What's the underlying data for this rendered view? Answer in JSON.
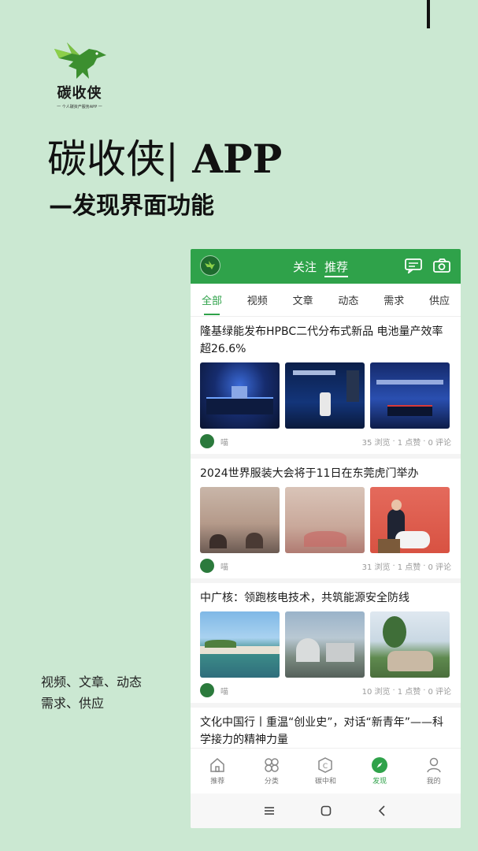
{
  "logo": {
    "name": "碳收侠",
    "tagline": "一 个人碳资产服务APP 一"
  },
  "hero": {
    "title_main": "碳收侠|",
    "title_app": " APP",
    "subtitle": "—发现界面功能"
  },
  "side_text": {
    "line1": "视频、文章、动态",
    "line2": "需求、供应"
  },
  "app": {
    "header": {
      "tabs": [
        "关注",
        "推荐"
      ],
      "active_tab": "推荐"
    },
    "categories": [
      "全部",
      "视频",
      "文章",
      "动态",
      "需求",
      "供应"
    ],
    "active_category": "全部",
    "posts": [
      {
        "title": "隆基绿能发布HPBC二代分布式新品 电池量产效率超26.6%",
        "author": "喵",
        "views": "35 浏览",
        "likes": "1 点赞",
        "comments": "0 评论"
      },
      {
        "title": "2024世界服装大会将于11日在东莞虎门举办",
        "author": "喵",
        "views": "31 浏览",
        "likes": "1 点赞",
        "comments": "0 评论"
      },
      {
        "title": "中广核：领跑核电技术，共筑能源安全防线",
        "author": "喵",
        "views": "10 浏览",
        "likes": "1 点赞",
        "comments": "0 评论"
      },
      {
        "title": "文化中国行丨重温“创业史”，对话“新青年”——科学接力的精神力量"
      }
    ],
    "separator": "·",
    "bottom_nav": [
      {
        "label": "推荐",
        "icon": "home-icon"
      },
      {
        "label": "分类",
        "icon": "grid-icon"
      },
      {
        "label": "碳中和",
        "icon": "carbon-icon"
      },
      {
        "label": "发现",
        "icon": "compass-icon"
      },
      {
        "label": "我的",
        "icon": "user-icon"
      }
    ],
    "active_nav": "发现"
  },
  "colors": {
    "background": "#cbe8d2",
    "brand_green": "#2fa24a"
  }
}
